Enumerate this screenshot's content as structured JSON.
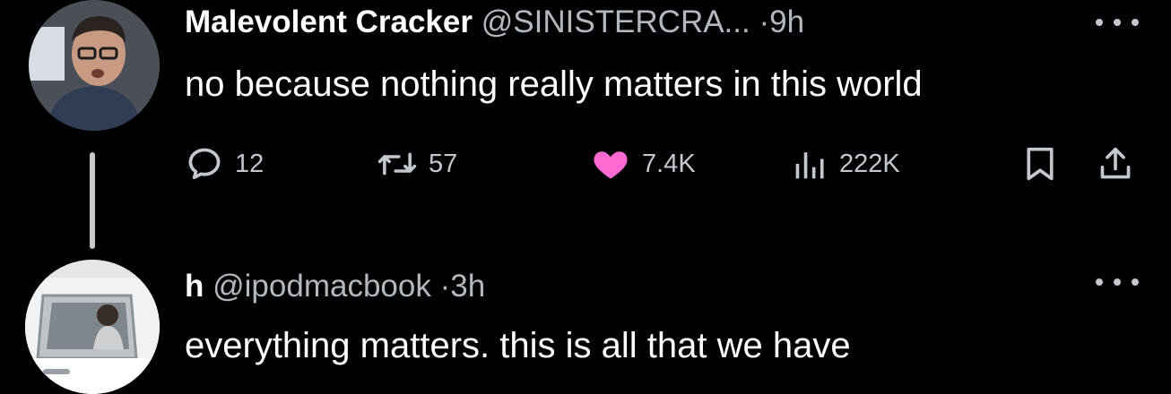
{
  "colors": {
    "background": "#000000",
    "text": "#ffffff",
    "secondary_text": "#b4b8bd",
    "like_pink": "#f91880",
    "thread_line": "#c8c8c8"
  },
  "tweets": [
    {
      "display_name": "Malevolent Cracker",
      "handle": "@SINISTERCRA...",
      "separator": "·",
      "time": "9h",
      "text": "no because nothing really matters in this world",
      "avatar_icon": "man-with-glasses-avatar",
      "actions": {
        "replies": "12",
        "retweets": "57",
        "likes": "7.4K",
        "views": "222K"
      },
      "liked": true
    },
    {
      "display_name": "h",
      "handle": "@ipodmacbook",
      "separator": "·",
      "time": "3h",
      "text": "everything matters. this is all that we have",
      "avatar_icon": "person-in-car-avatar"
    }
  ]
}
